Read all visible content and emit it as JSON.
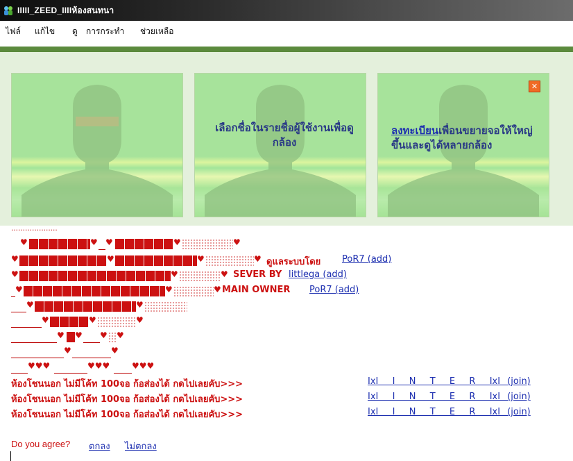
{
  "window": {
    "title": "IIIII_ZEED_IIIIห้องสนทนา"
  },
  "menu": [
    {
      "label": "ไฟล์"
    },
    {
      "label": "แก้ไข"
    },
    {
      "label": "ดู"
    },
    {
      "label": "การกระทำ"
    },
    {
      "label": "ช่วยเหลือ"
    }
  ],
  "panels": {
    "middle_text": "เลือกชื่อในรายชื่อผู้ใช้งานเพื่อดูกล้อง",
    "right_link": "ลงทะเบียน",
    "right_text": "เพื่อนขยายจอให้ใหญ่ขึ้นและดูได้หลายกล้อง",
    "close_label": "✕"
  },
  "art": {
    "dots": "....................",
    "rows": [
      {
        "label": "",
        "link": ""
      },
      {
        "label": "ดูแลระบบโดย",
        "link": "PoR7 (add)"
      },
      {
        "label": "SEVER BY",
        "link": "littlega (add)"
      },
      {
        "label": "MAIN OWNER",
        "link": "PoR7 (add)"
      }
    ]
  },
  "rooms": [
    {
      "text": "ห้องโชนนอก ไม่มีโค้ท 100จอ ก้อส่องได้ กดไปเลยคับ>>>",
      "link": "IxI  I  N  T  E  R  IxI (join)"
    },
    {
      "text": "ห้องโชนนอก ไม่มีโค้ท 100จอ ก้อส่องได้ กดไปเลยคับ>>>",
      "link": "IxI  I  N  T  E  R  IxI (join)"
    },
    {
      "text": "ห้องโชนนอก ไม่มีโค้ท 100จอ ก้อส่องได้ กดไปเลยคับ>>>",
      "link": "IxI  I  N  T  E  R  IxI (join)"
    }
  ],
  "agree": {
    "question": "Do you agree?",
    "yes": "ตกลง",
    "no": "ไม่ตกลง"
  },
  "colors": {
    "accent_red": "#cc1111",
    "link_blue": "#1d2fb0",
    "panel_green": "#a7e39b"
  },
  "icons": [
    "app-icon",
    "close-icon",
    "heart-icon",
    "silhouette-icon"
  ]
}
